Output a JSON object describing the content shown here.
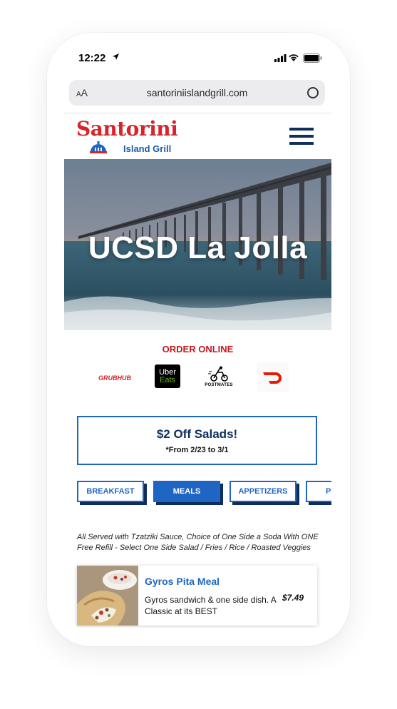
{
  "status_bar": {
    "time": "12:22"
  },
  "browser": {
    "aa_small": "A",
    "aa_large": "A",
    "url": "santoriniislandgrill.com"
  },
  "header": {
    "logo_title": "Santorini",
    "logo_subtitle": "Island Grill"
  },
  "hero": {
    "title": "UCSD La Jolla"
  },
  "order_online": {
    "title": "ORDER ONLINE",
    "grubhub": "GRUBHUB",
    "ubereats_line1": "Uber",
    "ubereats_line2": "Eats",
    "postmates": "POSTMATES"
  },
  "promo": {
    "title": "$2 Off Salads!",
    "subtitle": "*From 2/23 to 3/1"
  },
  "tabs": [
    {
      "label": "BREAKFAST",
      "active": false
    },
    {
      "label": "MEALS",
      "active": true
    },
    {
      "label": "APPETIZERS",
      "active": false
    },
    {
      "label": "PI",
      "active": false
    }
  ],
  "menu": {
    "description": "All Served with Tzatziki Sauce, Choice of One Side a Soda With ONE Free Refill - Select One Side Salad / Fries / Rice / Roasted Veggies",
    "items": [
      {
        "name": "Gyros Pita Meal",
        "description": "Gyros sandwich & one side dish. A Classic at its BEST",
        "price": "$7.49"
      }
    ]
  },
  "colors": {
    "brand_red": "#d8232a",
    "brand_blue": "#1f66c4",
    "navy": "#0e2e5c"
  }
}
